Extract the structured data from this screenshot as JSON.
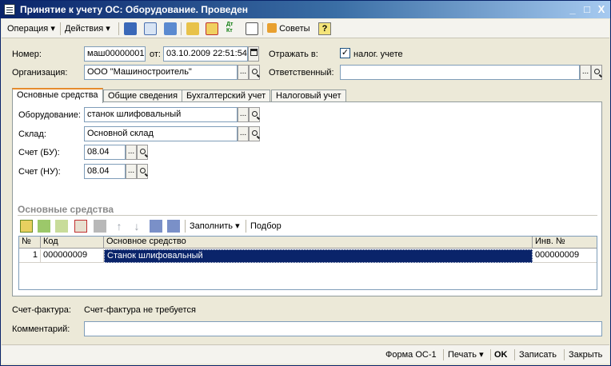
{
  "window": {
    "title": "Принятие к учету ОС: Оборудование. Проведен",
    "controls": {
      "minimize": "_",
      "maximize": "□",
      "close": "X"
    }
  },
  "toolbar": {
    "operation_label": "Операция",
    "actions_label": "Действия",
    "tips_label": "Советы",
    "help_label": "?",
    "dropdown_arrow": "▾",
    "dtkt_label": "Дт Кт"
  },
  "header": {
    "number_label": "Номер:",
    "number_value": "маш00000001",
    "date_label": "от:",
    "date_value": "03.10.2009 22:51:54",
    "reflect_label": "Отражать в:",
    "tax_check_label": "налог. учете",
    "tax_checked": "✓",
    "org_label": "Организация:",
    "org_value": "ООО \"Машиностроитель\"",
    "responsible_label": "Ответственный:",
    "responsible_value": "",
    "ellipsis": "..."
  },
  "tabs": [
    {
      "label": "Основные средства"
    },
    {
      "label": "Общие сведения"
    },
    {
      "label": "Бухгалтерский учет"
    },
    {
      "label": "Налоговый учет"
    }
  ],
  "main_tab": {
    "equipment_label": "Оборудование:",
    "equipment_value": "станок шлифовальный",
    "warehouse_label": "Склад:",
    "warehouse_value": "Основной склад",
    "account_bu_label": "Счет (БУ):",
    "account_bu_value": "08.04",
    "account_nu_label": "Счет (НУ):",
    "account_nu_value": "08.04",
    "group_title": "Основные средства",
    "fill_label": "Заполнить",
    "select_label": "Подбор"
  },
  "grid": {
    "columns": [
      "№",
      "Код",
      "Основное средство",
      "Инв. №"
    ],
    "rows": [
      {
        "n": "1",
        "code": "000000009",
        "asset": "Станок шлифовальный",
        "inv": "000000009"
      }
    ]
  },
  "bottom": {
    "invoice_label": "Счет-фактура:",
    "invoice_value": "Счет-фактура не требуется",
    "comment_label": "Комментарий:",
    "comment_value": ""
  },
  "footer": {
    "form_label": "Форма ОС-1",
    "print_label": "Печать",
    "ok_label": "OK",
    "save_label": "Записать",
    "close_label": "Закрыть"
  },
  "colors": {
    "title_start": "#0a246a",
    "selection": "#0a246a",
    "tab_accent": "#e68b2c",
    "field_border": "#7f9db9"
  }
}
